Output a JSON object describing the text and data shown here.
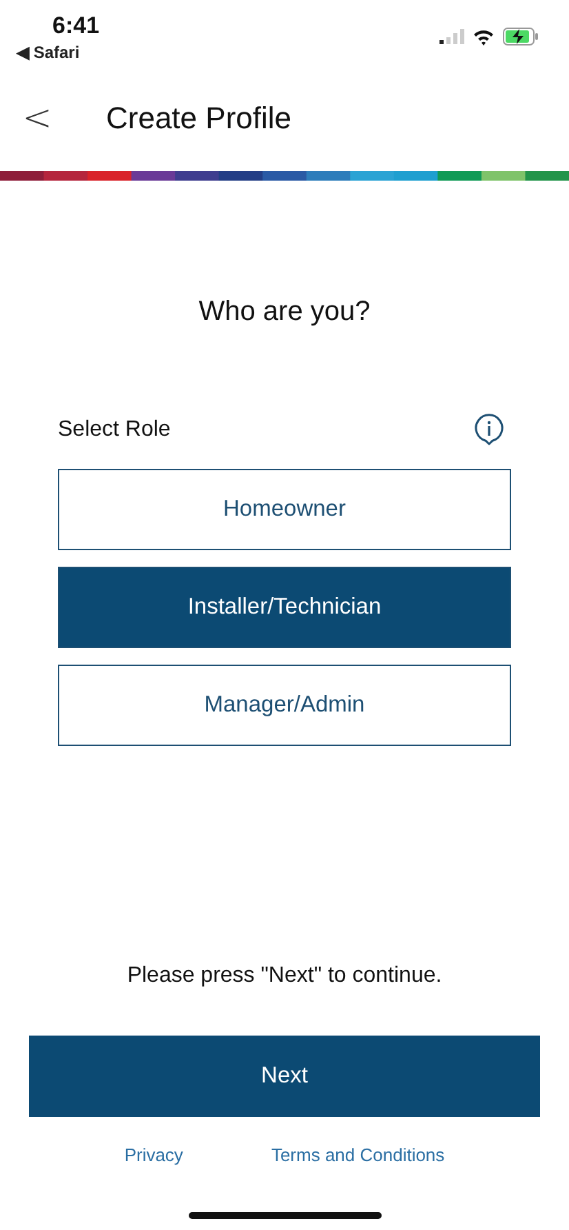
{
  "status_bar": {
    "time": "6:41",
    "back_app": "◀ Safari"
  },
  "header": {
    "back": "<",
    "title": "Create Profile"
  },
  "heading": "Who are you?",
  "role_label": "Select Role",
  "roles": [
    {
      "label": "Homeowner",
      "selected": false
    },
    {
      "label": "Installer/Technician",
      "selected": true
    },
    {
      "label": "Manager/Admin",
      "selected": false
    }
  ],
  "hint": "Please press \"Next\" to continue.",
  "next_button": "Next",
  "links": [
    "Privacy",
    "Terms and Conditions"
  ]
}
